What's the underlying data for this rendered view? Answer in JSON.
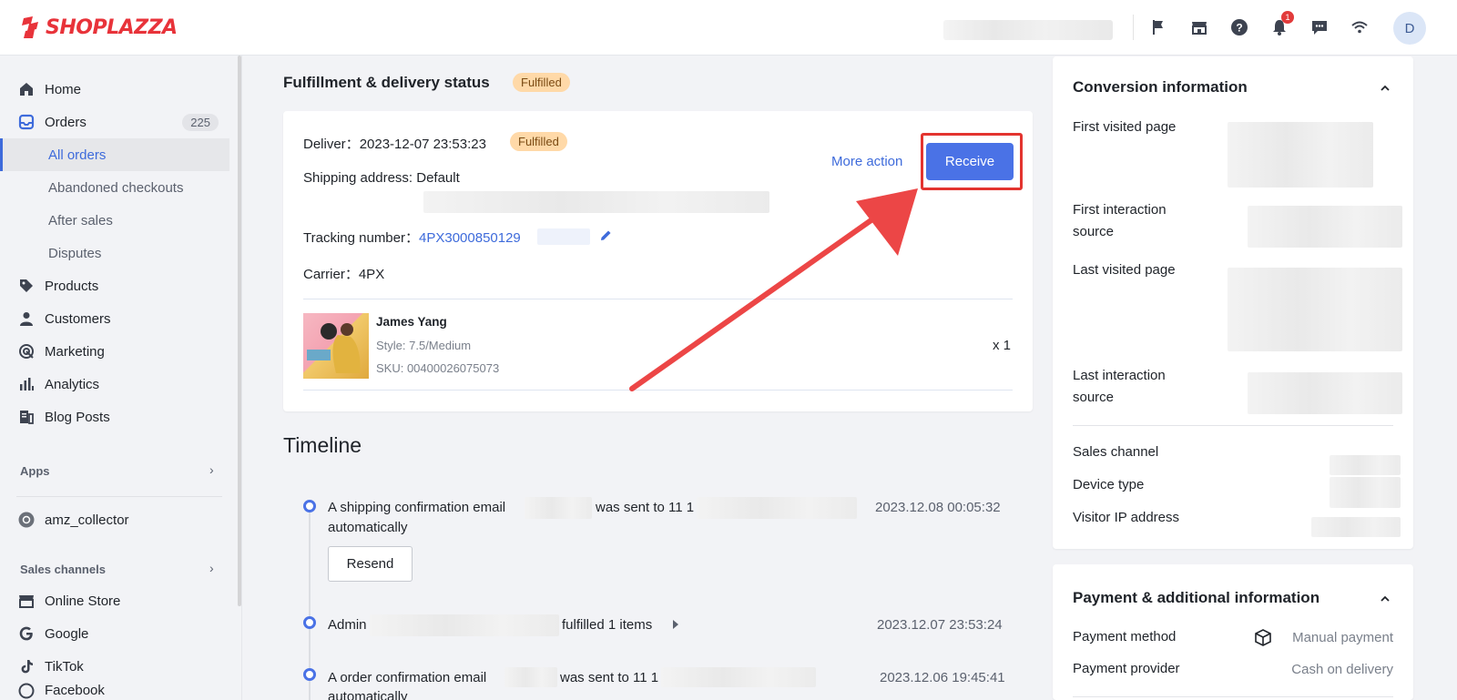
{
  "brand": {
    "name": "SHOPLAZZA",
    "color": "#e8333a"
  },
  "topbar": {
    "icons": [
      "flag-icon",
      "store-icon",
      "help-icon",
      "bell-icon",
      "chat-icon",
      "wifi-icon"
    ],
    "notification_count": "1",
    "avatar_initial": "D"
  },
  "sidebar": {
    "items": [
      {
        "label": "Home",
        "icon": "home-icon"
      },
      {
        "label": "Orders",
        "icon": "orders-icon",
        "count": "225"
      },
      {
        "label": "Products",
        "icon": "tag-icon"
      },
      {
        "label": "Customers",
        "icon": "person-icon"
      },
      {
        "label": "Marketing",
        "icon": "marketing-icon"
      },
      {
        "label": "Analytics",
        "icon": "bar-chart-icon"
      },
      {
        "label": "Blog Posts",
        "icon": "blog-icon"
      }
    ],
    "orders_sub": [
      "All orders",
      "Abandoned checkouts",
      "After sales",
      "Disputes"
    ],
    "apps_label": "Apps",
    "app_item": "amz_collector",
    "sales_channels_label": "Sales channels",
    "channels": [
      "Online Store",
      "Google",
      "TikTok",
      "Facebook"
    ]
  },
  "fulfillment": {
    "title": "Fulfillment & delivery status",
    "status_badge": "Fulfilled",
    "deliver_label": "Deliver：",
    "deliver_date": "2023-12-07 23:53:23",
    "deliver_badge": "Fulfilled",
    "shipping_address": "Shipping address: Default",
    "tracking_label": "Tracking number：",
    "tracking_number": "4PX3000850129",
    "carrier_label": "Carrier：",
    "carrier": "4PX",
    "more_action": "More action",
    "receive": "Receive",
    "product": {
      "name": "James Yang",
      "style": "Style: 7.5/Medium",
      "sku": "SKU: 00400026075073",
      "qty": "x 1"
    }
  },
  "timeline": {
    "title": "Timeline",
    "events": [
      {
        "text_a": "A shipping confirmation email",
        "text_b": "was sent to 11 1",
        "text_c": "automatically",
        "time": "2023.12.08 00:05:32"
      },
      {
        "text_a": "Admin",
        "text_b": "fulfilled 1 items",
        "time": "2023.12.07 23:53:24"
      },
      {
        "text_a": "A order confirmation email",
        "text_b": "was sent to 11 1",
        "text_c": "automatically",
        "time": "2023.12.06 19:45:41"
      }
    ],
    "resend": "Resend"
  },
  "conversion": {
    "title": "Conversion information",
    "first_visited": "First visited page",
    "first_interaction": "First interaction source",
    "last_visited": "Last visited page",
    "last_interaction": "Last interaction source",
    "sales_channel": "Sales channel",
    "device_type": "Device type",
    "visitor_ip": "Visitor IP address"
  },
  "payment": {
    "title": "Payment & additional information",
    "method_label": "Payment method",
    "method_value": "Manual payment",
    "provider_label": "Payment provider",
    "provider_value": "Cash on delivery"
  },
  "colors": {
    "accent": "#4a72e6",
    "highlight": "#e3342f",
    "badge": "#ffd9a8"
  }
}
